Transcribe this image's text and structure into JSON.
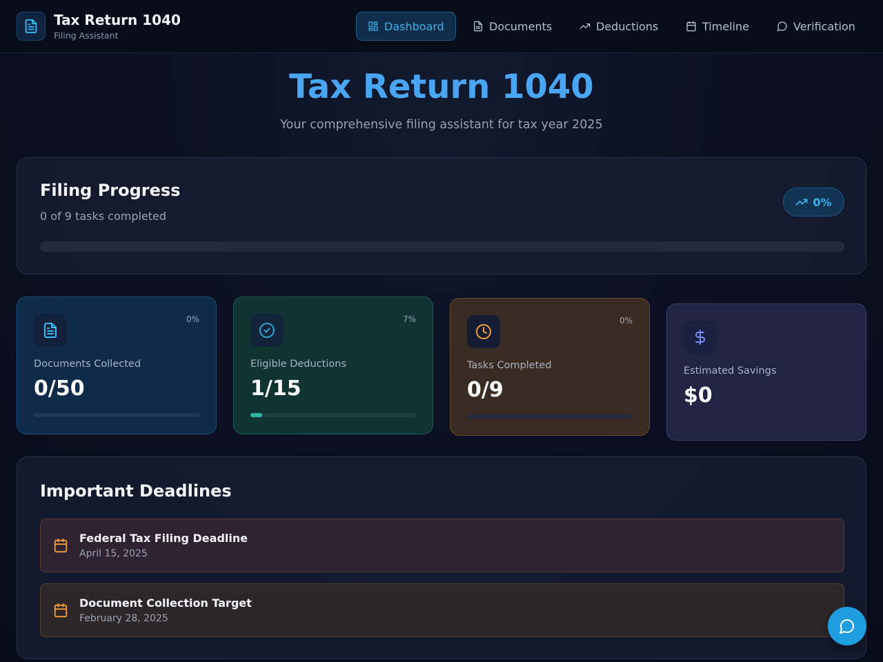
{
  "header": {
    "app_title": "Tax Return 1040",
    "app_subtitle": "Filing Assistant",
    "nav": [
      {
        "label": "Dashboard",
        "icon": "dashboard-icon",
        "active": true
      },
      {
        "label": "Documents",
        "icon": "document-icon",
        "active": false
      },
      {
        "label": "Deductions",
        "icon": "trending-up-icon",
        "active": false
      },
      {
        "label": "Timeline",
        "icon": "calendar-icon",
        "active": false
      },
      {
        "label": "Verification",
        "icon": "message-icon",
        "active": false
      }
    ]
  },
  "hero": {
    "title": "Tax Return 1040",
    "subtitle": "Your comprehensive filing assistant for tax year 2025"
  },
  "filing_progress": {
    "title": "Filing Progress",
    "subtitle": "0 of 9 tasks completed",
    "badge": "0%",
    "progress_fraction": 0.0
  },
  "stats": [
    {
      "label": "Documents Collected",
      "value": "0/50",
      "percent": "0%",
      "progress_fraction": 0.0,
      "icon": "document-icon",
      "color": "#38bdf8"
    },
    {
      "label": "Eligible Deductions",
      "value": "1/15",
      "percent": "7%",
      "progress_fraction": 0.07,
      "icon": "check-circle-icon",
      "color": "#2fb3a7"
    },
    {
      "label": "Tasks Completed",
      "value": "0/9",
      "percent": "0%",
      "progress_fraction": 0.0,
      "icon": "clock-icon",
      "color": "#f59e3b"
    },
    {
      "label": "Estimated Savings",
      "value": "$0",
      "icon": "dollar-icon",
      "color": "#7c8cf5"
    }
  ],
  "deadlines": {
    "title": "Important Deadlines",
    "items": [
      {
        "name": "Federal Tax Filing Deadline",
        "date": "April 15, 2025"
      },
      {
        "name": "Document Collection Target",
        "date": "February 28, 2025"
      }
    ]
  },
  "colors": {
    "accent": "#38bdf8",
    "hero": "#4aa6f3",
    "deadline_icon": "#f59e3b"
  }
}
